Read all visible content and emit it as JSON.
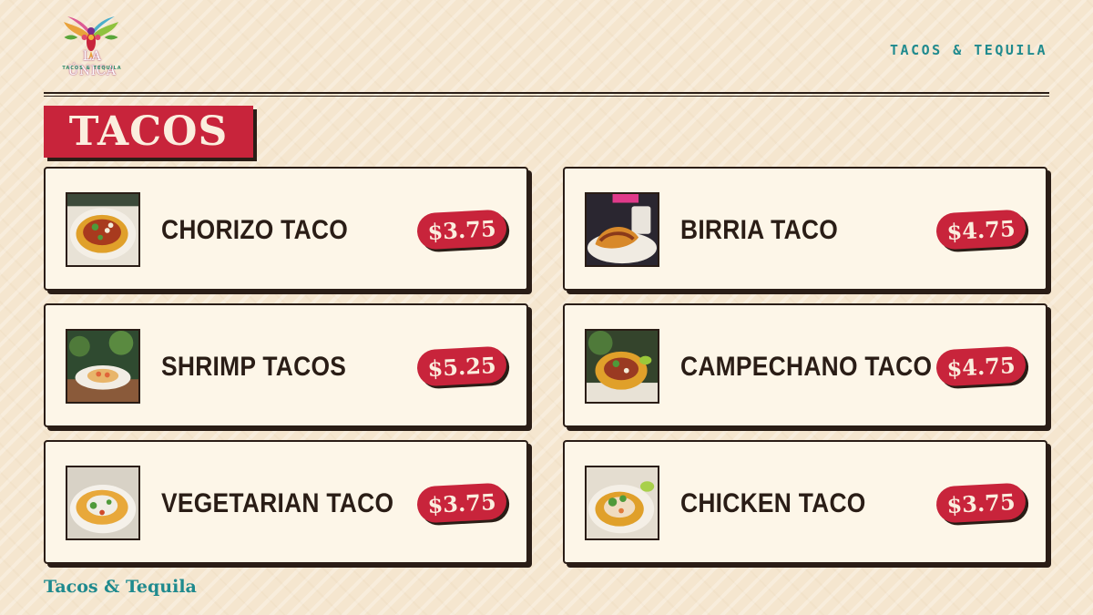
{
  "brand": {
    "logo_text": "LA ÚNICA",
    "logo_sub": "TACOS & TEQUILA",
    "header_tag": "TACOS & TEQUILA",
    "footer_tag": "Tacos & Tequila"
  },
  "section": {
    "title": "TACOS"
  },
  "menu": {
    "items": [
      {
        "name": "CHORIZO TACO",
        "price": "$3.75",
        "photo": "chorizo-taco-photo"
      },
      {
        "name": "BIRRIA TACO",
        "price": "$4.75",
        "photo": "birria-taco-photo"
      },
      {
        "name": "SHRIMP TACOS",
        "price": "$5.25",
        "photo": "shrimp-tacos-photo"
      },
      {
        "name": "CAMPECHANO TACO",
        "price": "$4.75",
        "photo": "campechano-taco-photo"
      },
      {
        "name": "VEGETARIAN TACO",
        "price": "$3.75",
        "photo": "vegetarian-taco-photo"
      },
      {
        "name": "CHICKEN TACO",
        "price": "$3.75",
        "photo": "chicken-taco-photo"
      }
    ]
  },
  "colors": {
    "background": "#f5e6cf",
    "card": "#fdf6e8",
    "accent_red": "#c8243b",
    "ink": "#2a1d16",
    "teal": "#1f8a8e"
  }
}
